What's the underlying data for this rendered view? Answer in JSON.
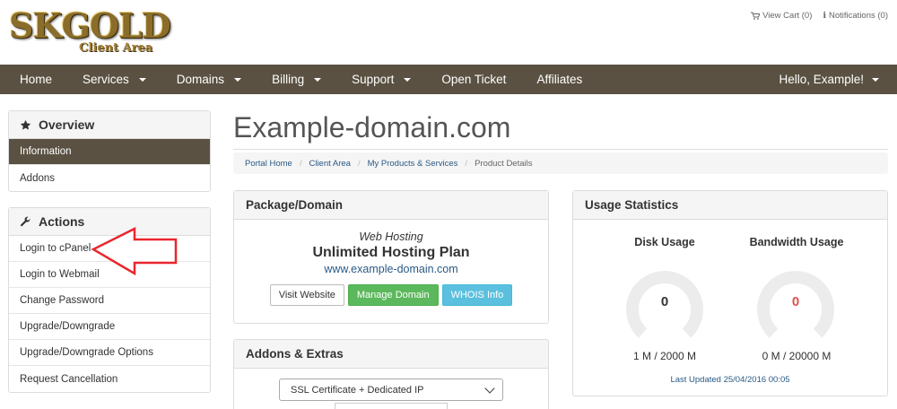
{
  "logo": {
    "main": "SKGOLD",
    "sub": "Client Area"
  },
  "top_links": {
    "cart": "View Cart (0)",
    "notifications": "Notifications (0)"
  },
  "nav": {
    "home": "Home",
    "services": "Services",
    "domains": "Domains",
    "billing": "Billing",
    "support": "Support",
    "open_ticket": "Open Ticket",
    "affiliates": "Affiliates",
    "user": "Hello, Example!"
  },
  "sidebar": {
    "overview": {
      "title": "Overview",
      "items": [
        "Information",
        "Addons"
      ]
    },
    "actions": {
      "title": "Actions",
      "items": [
        "Login to cPanel",
        "Login to Webmail",
        "Change Password",
        "Upgrade/Downgrade",
        "Upgrade/Downgrade Options",
        "Request Cancellation"
      ]
    }
  },
  "page": {
    "title": "Example-domain.com",
    "breadcrumb": [
      "Portal Home",
      "Client Area",
      "My Products & Services",
      "Product Details"
    ]
  },
  "package": {
    "header": "Package/Domain",
    "type": "Web Hosting",
    "name": "Unlimited Hosting Plan",
    "domain": "www.example-domain.com",
    "buttons": {
      "visit": "Visit Website",
      "manage": "Manage Domain",
      "whois": "WHOIS Info"
    }
  },
  "addons": {
    "header": "Addons & Extras",
    "selected": "SSL Certificate + Dedicated IP"
  },
  "usage": {
    "header": "Usage Statistics",
    "disk": {
      "label": "Disk Usage",
      "value": "0",
      "amount": "1 M / 2000 M",
      "color": "#333333"
    },
    "bandwidth": {
      "label": "Bandwidth Usage",
      "value": "0",
      "amount": "0 M / 20000 M",
      "color": "#d9534f"
    },
    "last_updated": "Last Updated 25/04/2016 00:05"
  },
  "colors": {
    "nav_bg": "#5a5142",
    "arrow": "#e8262d",
    "link": "#2a5a86"
  }
}
